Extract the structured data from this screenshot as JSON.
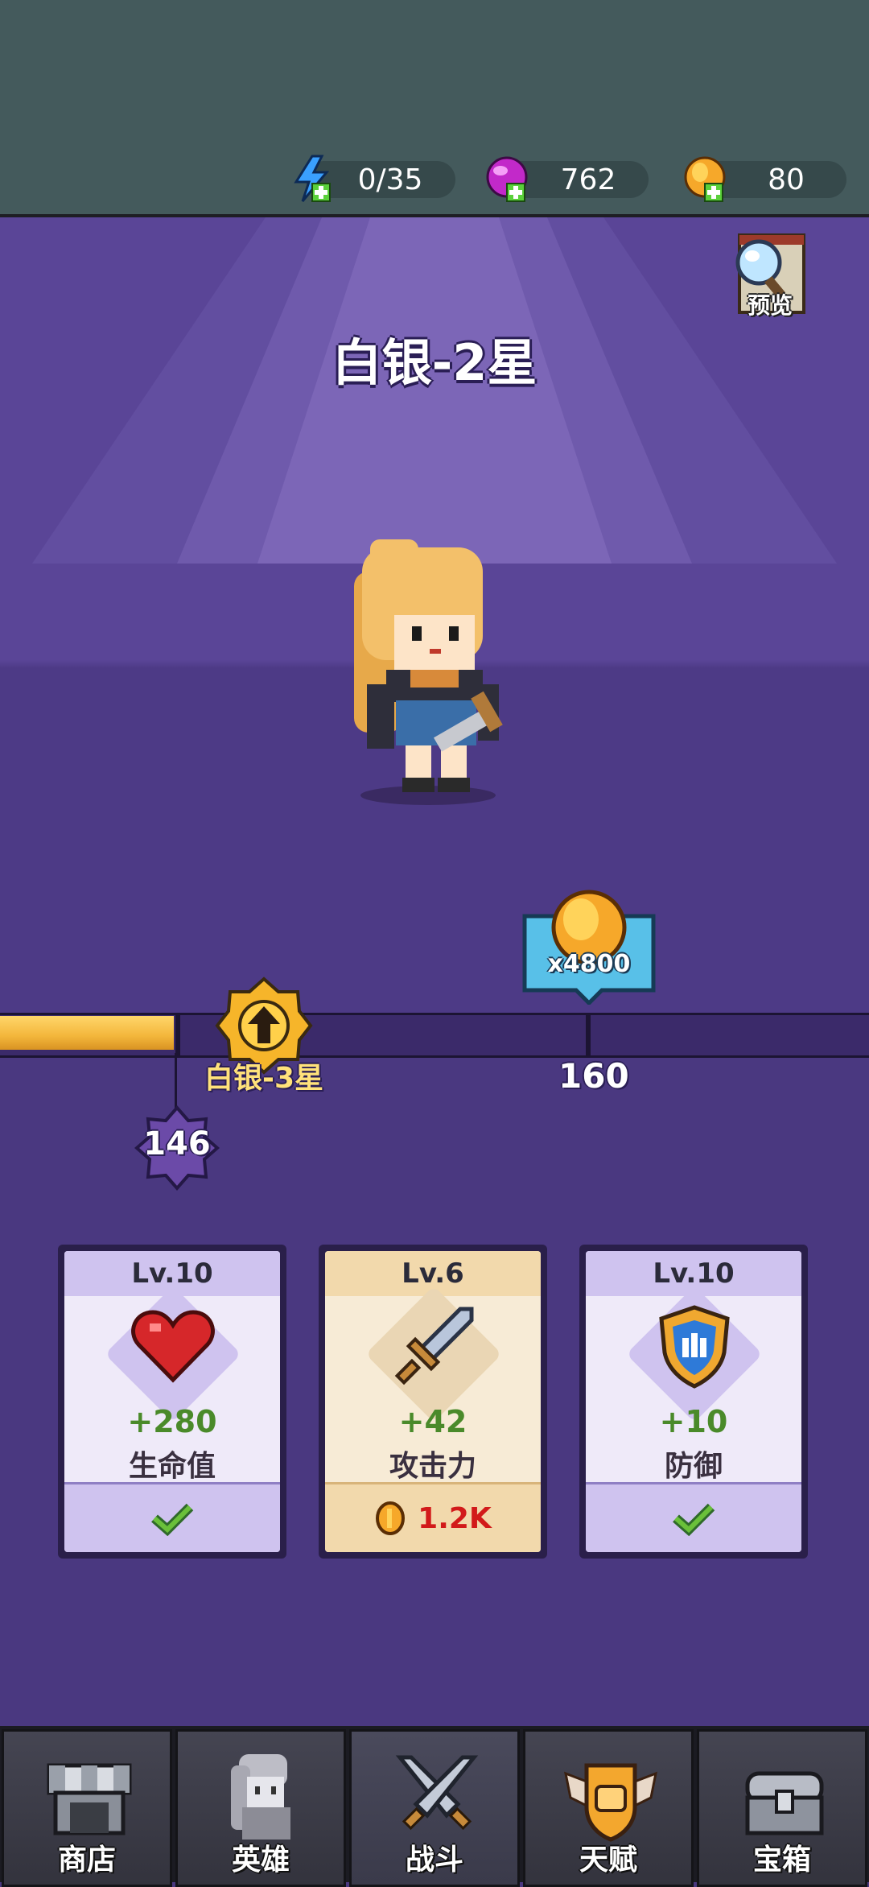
{
  "resources": {
    "energy": {
      "value": "0/35",
      "icon": "energy-icon"
    },
    "gems": {
      "value": "762",
      "icon": "gem-icon"
    },
    "coins": {
      "value": "80",
      "icon": "coin-icon"
    }
  },
  "stage": {
    "rank_title": "白银-2星",
    "preview_label": "预览"
  },
  "progress": {
    "current_value": "146",
    "fill_fraction": 0.2,
    "next_rank_label": "白银-3星",
    "next_milestone": "160",
    "reward_text": "x4800"
  },
  "cards": [
    {
      "level": "Lv.10",
      "bonus": "+280",
      "stat": "生命值",
      "icon": "heart-icon",
      "status": "completed"
    },
    {
      "level": "Lv.6",
      "bonus": "+42",
      "stat": "攻击力",
      "icon": "sword-icon",
      "cost": "1.2K"
    },
    {
      "level": "Lv.10",
      "bonus": "+10",
      "stat": "防御",
      "icon": "shield-icon",
      "status": "completed"
    }
  ],
  "nav": {
    "items": [
      {
        "label": "商店",
        "icon": "shop-icon"
      },
      {
        "label": "英雄",
        "icon": "hero-icon"
      },
      {
        "label": "战斗",
        "icon": "crossed-swords-icon"
      },
      {
        "label": "天赋",
        "icon": "talent-fist-icon"
      },
      {
        "label": "宝箱",
        "icon": "chest-icon"
      }
    ],
    "active": "战斗"
  },
  "colors": {
    "background": "#4a3880",
    "topbar": "#445a5c",
    "progress_fill": "#f3b63b",
    "cost_red": "#d21a1a",
    "bonus_green": "#4a8a2a"
  }
}
